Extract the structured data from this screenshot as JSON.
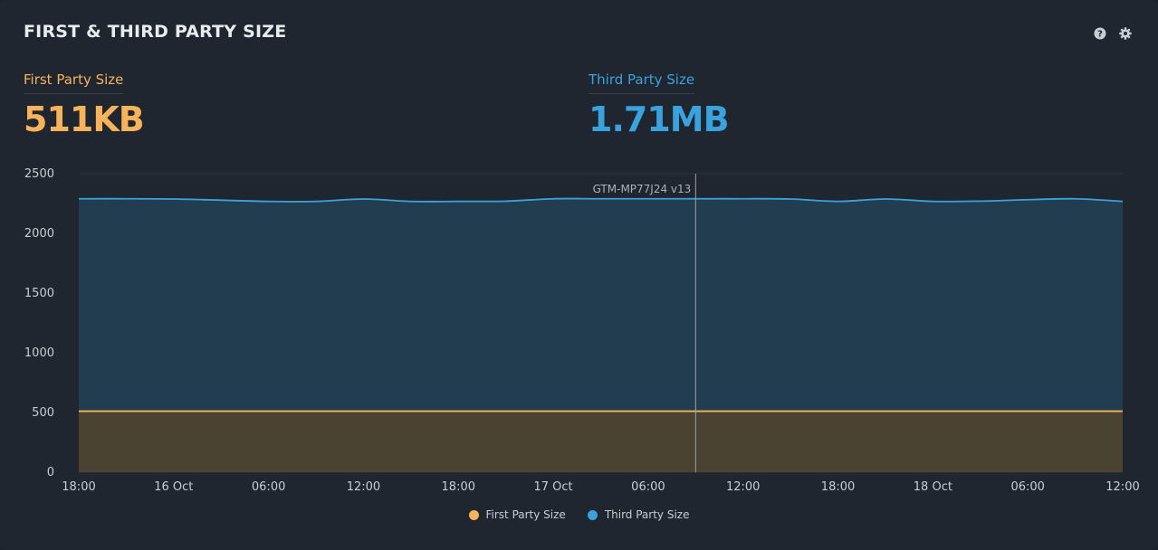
{
  "header": {
    "title": "FIRST & THIRD PARTY SIZE",
    "help_icon": "question-circle-icon",
    "settings_icon": "gear-icon"
  },
  "metrics": {
    "first": {
      "label": "First Party Size",
      "value": "511KB"
    },
    "third": {
      "label": "Third Party Size",
      "value": "1.71MB"
    }
  },
  "colors": {
    "first": "#f6b35c",
    "third": "#3aa3dd",
    "first_fill": "#4a4332",
    "third_fill": "#213d4f"
  },
  "chart_data": {
    "type": "area",
    "stacked": false,
    "x_tick_labels": [
      "18:00",
      "16 Oct",
      "06:00",
      "12:00",
      "18:00",
      "17 Oct",
      "06:00",
      "12:00",
      "18:00",
      "18 Oct",
      "06:00",
      "12:00"
    ],
    "ylim": [
      0,
      2500
    ],
    "yticks": [
      0,
      500,
      1000,
      1500,
      2000,
      2500
    ],
    "grid": true,
    "legend_position": "bottom",
    "x": [
      0,
      3,
      6,
      9,
      12,
      15,
      18,
      21,
      24,
      27,
      30,
      33,
      36,
      39,
      42,
      45,
      48,
      51,
      54,
      57,
      60,
      63,
      66
    ],
    "series": [
      {
        "name": "First Party Size",
        "values": [
          511,
          511,
          511,
          511,
          511,
          511,
          511,
          511,
          511,
          511,
          511,
          511,
          511,
          511,
          511,
          511,
          511,
          511,
          511,
          511,
          511,
          511,
          511
        ]
      },
      {
        "name": "Third Party Size",
        "values": [
          2290,
          2290,
          2288,
          2278,
          2268,
          2268,
          2288,
          2268,
          2268,
          2270,
          2290,
          2290,
          2290,
          2290,
          2290,
          2288,
          2268,
          2288,
          2268,
          2270,
          2282,
          2290,
          2268
        ]
      }
    ],
    "annotation": {
      "label": "GTM-MP77J24 v13",
      "x": 39
    }
  }
}
